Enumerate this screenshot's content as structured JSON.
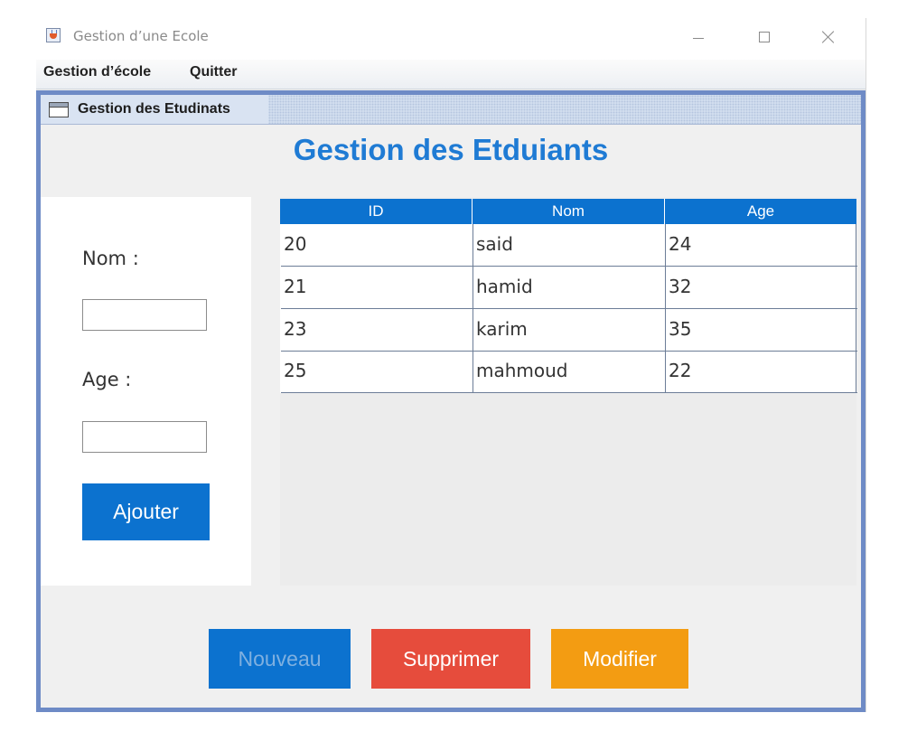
{
  "window": {
    "title": "Gestion d’une Ecole",
    "controls": [
      "minimize-icon",
      "maximize-icon",
      "close-icon"
    ]
  },
  "menubar": {
    "items": [
      {
        "label": "Gestion d’école"
      },
      {
        "label": "Quitter"
      }
    ]
  },
  "internal_frame": {
    "title": "Gestion des Etudinats",
    "icon": "window-icon"
  },
  "heading": "Gestion des Etduiants",
  "form": {
    "nom_label": "Nom :",
    "nom_value": "",
    "age_label": "Age :",
    "age_value": "",
    "add_button": "Ajouter"
  },
  "table": {
    "columns": [
      "ID",
      "Nom",
      "Age"
    ],
    "rows": [
      [
        "20",
        "said",
        "24"
      ],
      [
        "21",
        "hamid",
        "32"
      ],
      [
        "23",
        "karim",
        "35"
      ],
      [
        "25",
        "mahmoud",
        "22"
      ]
    ]
  },
  "actions": {
    "new_label": "Nouveau",
    "delete_label": "Supprimer",
    "edit_label": "Modifier"
  },
  "colors": {
    "primary_blue": "#0c72cf",
    "heading_blue": "#1f7bd4",
    "delete_red": "#e64c3c",
    "edit_orange": "#f39c12",
    "frame_border": "#6e8bc6"
  }
}
